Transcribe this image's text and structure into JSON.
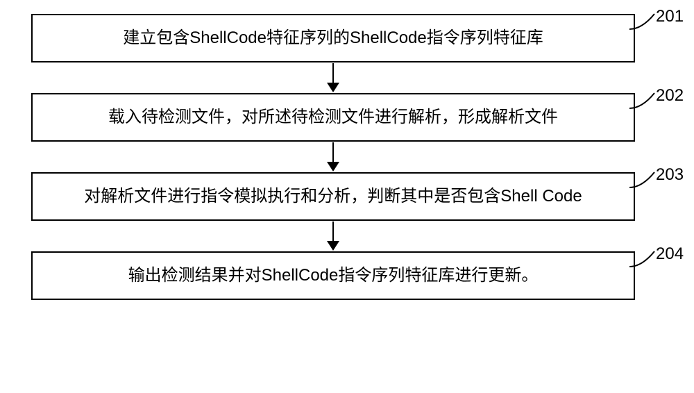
{
  "chart_data": {
    "type": "flowchart",
    "direction": "top-to-bottom",
    "steps": [
      {
        "id": "201",
        "text": "建立包含ShellCode特征序列的ShellCode指令序列特征库"
      },
      {
        "id": "202",
        "text": "载入待检测文件，对所述待检测文件进行解析，形成解析文件"
      },
      {
        "id": "203",
        "text": "对解析文件进行指令模拟执行和分析，判断其中是否包含Shell Code"
      },
      {
        "id": "204",
        "text": "输出检测结果并对ShellCode指令序列特征库进行更新。"
      }
    ],
    "edges": [
      {
        "from": "201",
        "to": "202"
      },
      {
        "from": "202",
        "to": "203"
      },
      {
        "from": "203",
        "to": "204"
      }
    ]
  },
  "labels": {
    "s1": "201",
    "s2": "202",
    "s3": "203",
    "s4": "204"
  }
}
